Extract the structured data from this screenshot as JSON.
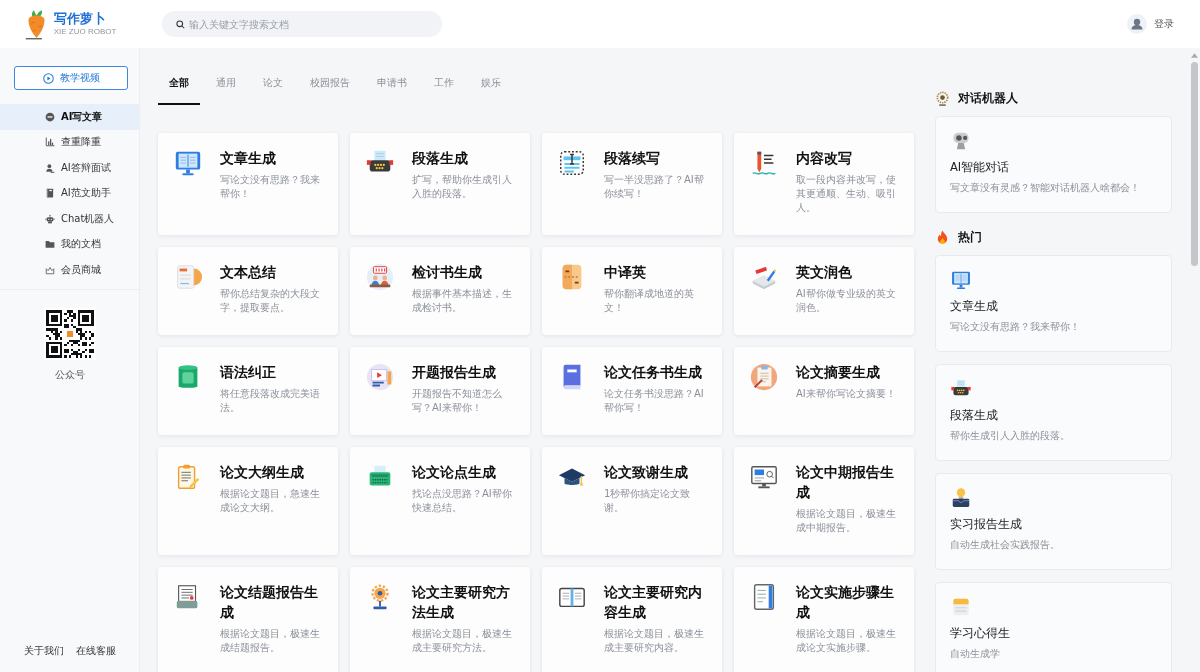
{
  "header": {
    "logo": {
      "name": "写作萝卜",
      "subtitle": "XIE ZUO ROBOT"
    },
    "search": {
      "placeholder": "输入关键文字搜索文档"
    },
    "login": "登录"
  },
  "sidebar": {
    "video_button": "教学视频",
    "items": [
      {
        "label": "AI写文章",
        "selected": true
      },
      {
        "label": "查重降重",
        "selected": false
      },
      {
        "label": "AI答辩面试",
        "selected": false
      },
      {
        "label": "AI范文助手",
        "selected": false
      },
      {
        "label": "Chat机器人",
        "selected": false
      },
      {
        "label": "我的文档",
        "selected": false
      },
      {
        "label": "会员商城",
        "selected": false
      }
    ],
    "qr_caption": "公众号",
    "footer_links": [
      "关于我们",
      "在线客服"
    ]
  },
  "tabs": [
    {
      "label": "全部",
      "selected": true
    },
    {
      "label": "通用",
      "selected": false
    },
    {
      "label": "论文",
      "selected": false
    },
    {
      "label": "校园报告",
      "selected": false
    },
    {
      "label": "申请书",
      "selected": false
    },
    {
      "label": "工作",
      "selected": false
    },
    {
      "label": "娱乐",
      "selected": false
    }
  ],
  "cards": [
    {
      "title": "文章生成",
      "description": "写论文没有思路？我来帮你！"
    },
    {
      "title": "段落生成",
      "description": "扩写，帮助你生成引人入胜的段落。"
    },
    {
      "title": "段落续写",
      "description": "写一半没思路了？AI帮你续写！"
    },
    {
      "title": "内容改写",
      "description": "取一段内容并改写，使其更通顺、生动、吸引人。"
    },
    {
      "title": "文本总结",
      "description": "帮你总结复杂的大段文字，提取要点。"
    },
    {
      "title": "检讨书生成",
      "description": "根据事件基本描述，生成检讨书。"
    },
    {
      "title": "中译英",
      "description": "帮你翻译成地道的英文！"
    },
    {
      "title": "英文润色",
      "description": "AI帮你做专业级的英文润色。"
    },
    {
      "title": "语法纠正",
      "description": "将任意段落改成完美语法。"
    },
    {
      "title": "开题报告生成",
      "description": "开题报告不知道怎么写？AI来帮你！"
    },
    {
      "title": "论文任务书生成",
      "description": "论文任务书没思路？AI帮你写！"
    },
    {
      "title": "论文摘要生成",
      "description": "AI来帮你写论文摘要！"
    },
    {
      "title": "论文大纲生成",
      "description": "根据论文题目，急速生成论文大纲。"
    },
    {
      "title": "论文论点生成",
      "description": "找论点没思路？AI帮你快速总结。"
    },
    {
      "title": "论文致谢生成",
      "description": "1秒帮你搞定论文致谢。"
    },
    {
      "title": "论文中期报告生成",
      "description": "根据论文题目，极速生成中期报告。"
    },
    {
      "title": "论文结题报告生成",
      "description": "根据论文题目，极速生成结题报告。"
    },
    {
      "title": "论文主要研究方法生成",
      "description": "根据论文题目，极速生成主要研究方法。"
    },
    {
      "title": "论文主要研究内容生成",
      "description": "根据论文题目，极速生成主要研究内容。"
    },
    {
      "title": "论文实施步骤生成",
      "description": "根据论文题目，极速生成论文实施步骤。"
    }
  ],
  "right_panel": {
    "sections": [
      {
        "title": "对话机器人",
        "cards": [
          {
            "title": "AI智能对话",
            "description": "写文章没有灵感？智能对话机器人啥都会！"
          }
        ]
      },
      {
        "title": "热门",
        "cards": [
          {
            "title": "文章生成",
            "description": "写论文没有思路？我来帮你！"
          },
          {
            "title": "段落生成",
            "description": "帮你生成引人入胜的段落。"
          },
          {
            "title": "实习报告生成",
            "description": "自动生成社会实践报告。"
          },
          {
            "title": "学习心得生",
            "description": "自动生成学"
          }
        ]
      }
    ]
  }
}
